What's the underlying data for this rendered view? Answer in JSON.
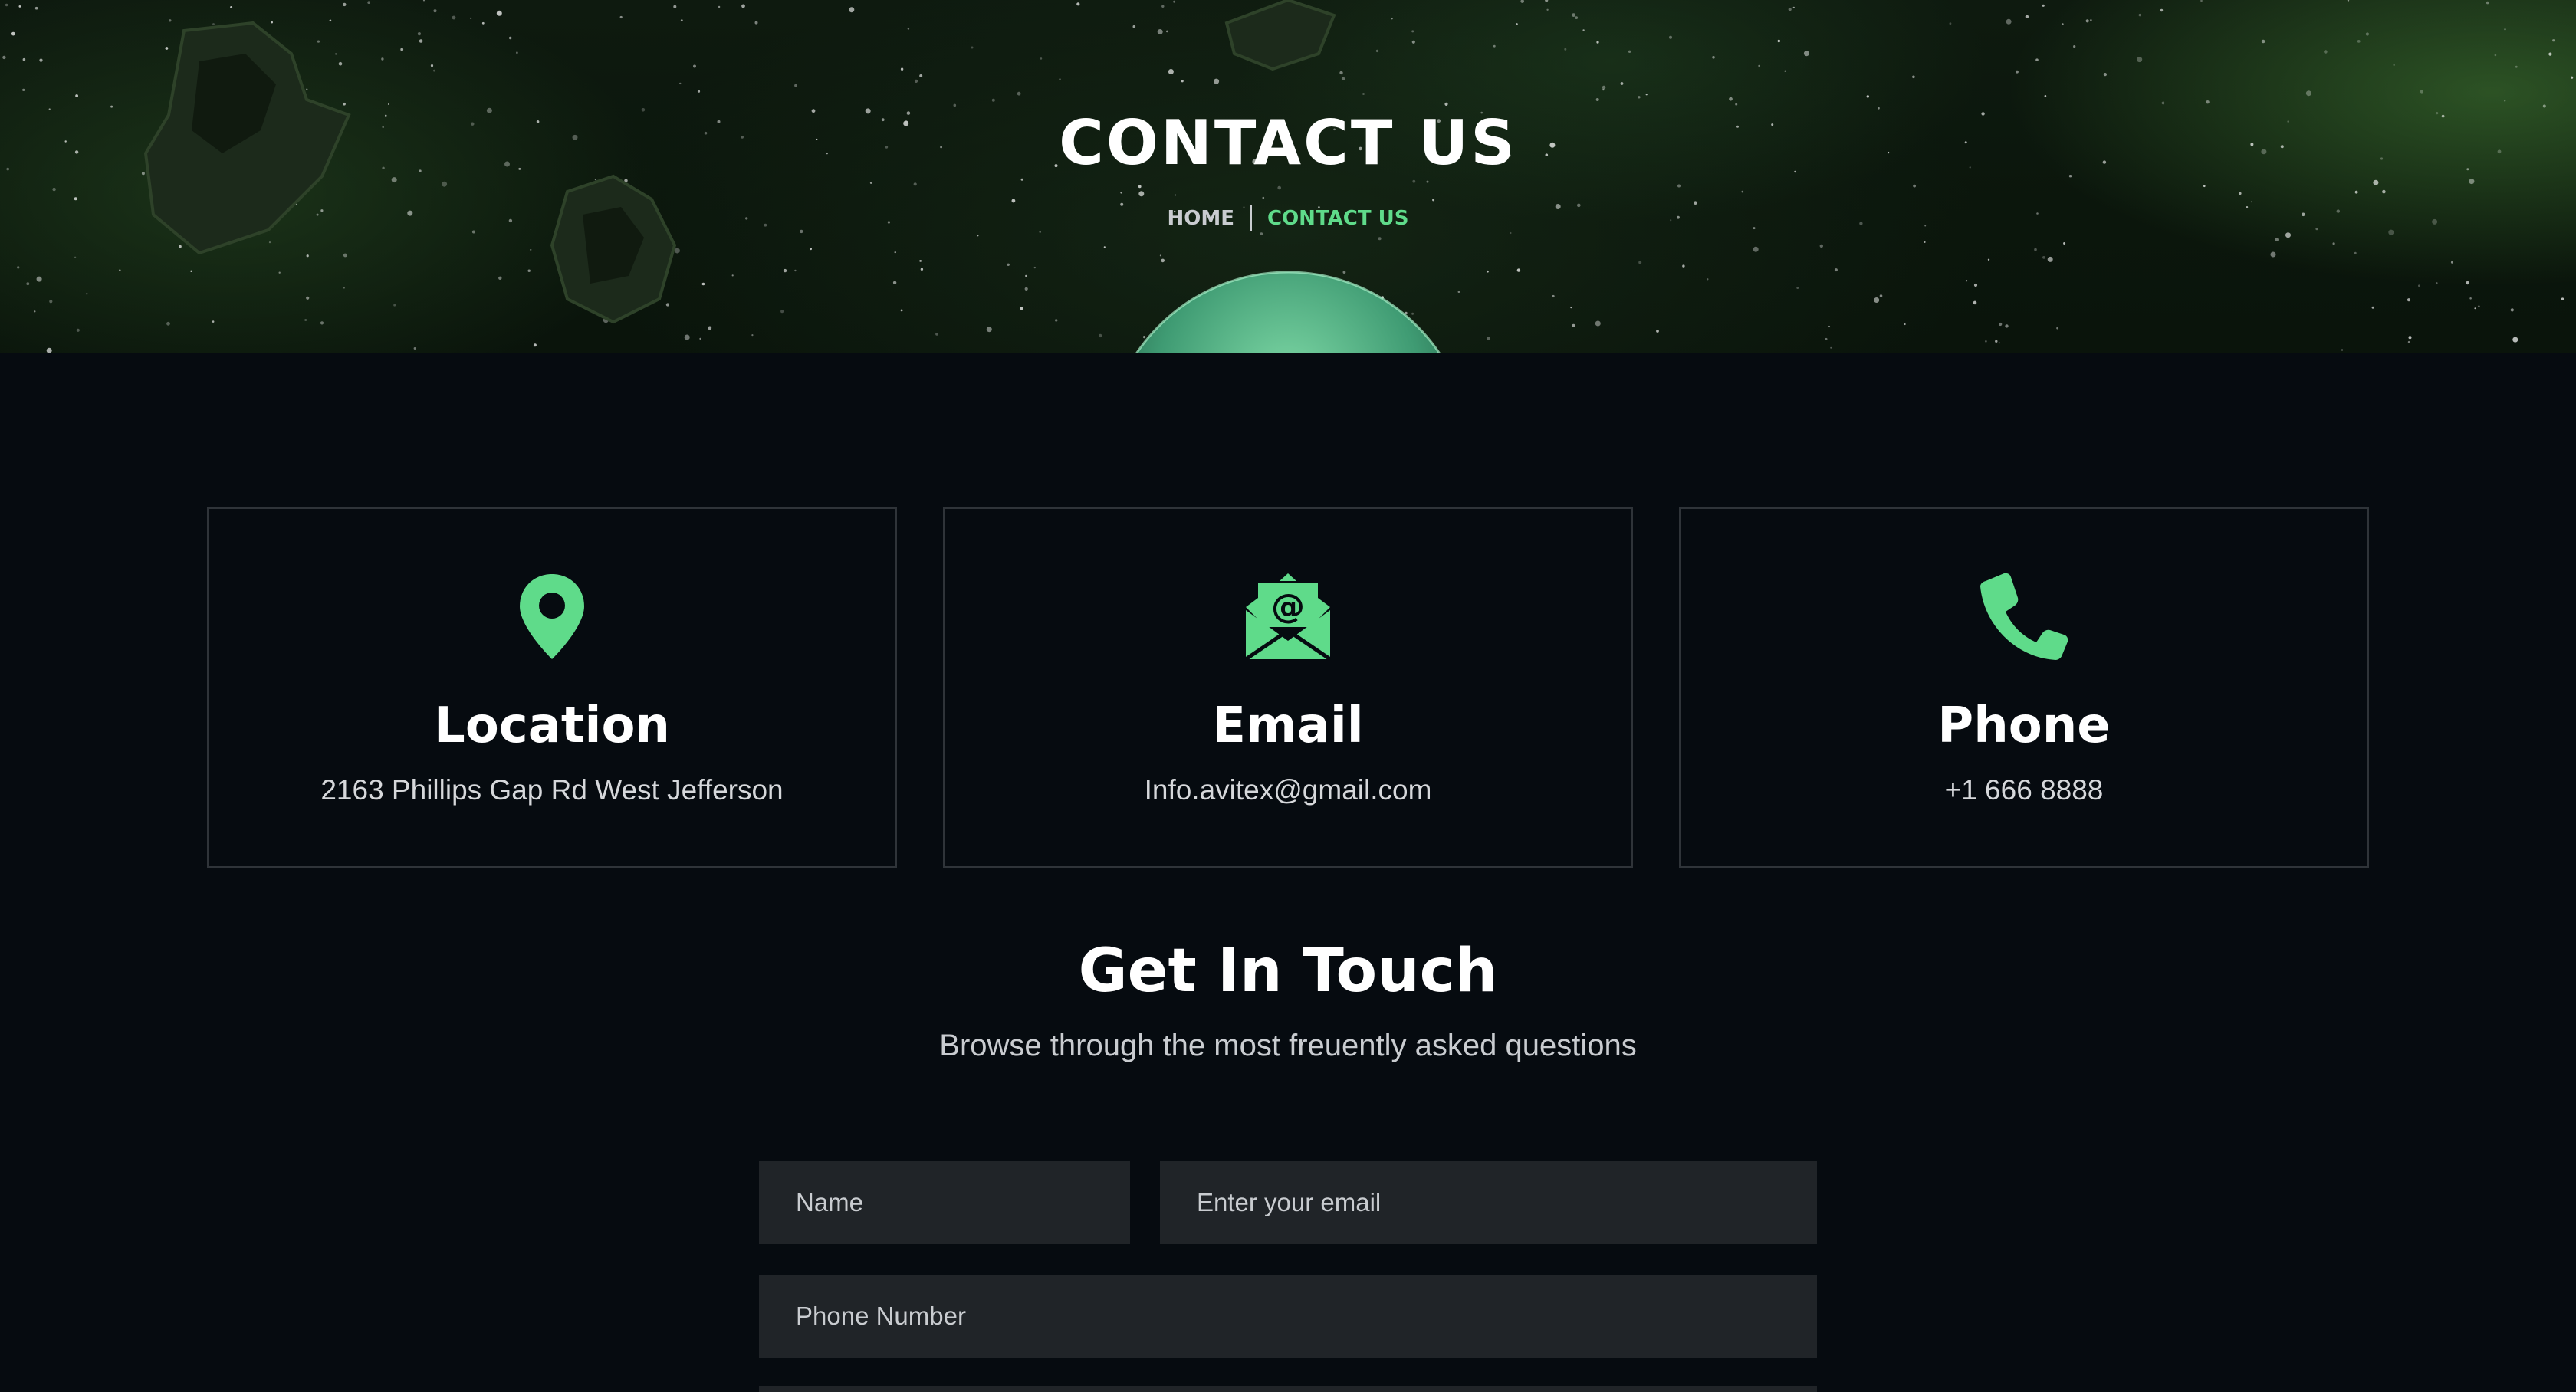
{
  "hero": {
    "title": "CONTACT US",
    "breadcrumb": {
      "home": "HOME",
      "current": "CONTACT US"
    }
  },
  "cards": [
    {
      "icon": "map-pin-icon",
      "title": "Location",
      "text": "2163 Phillips Gap Rd West Jefferson"
    },
    {
      "icon": "envelope-at-icon",
      "title": "Email",
      "text": "Info.avitex@gmail.com"
    },
    {
      "icon": "phone-icon",
      "title": "Phone",
      "text": "+1 666 8888"
    }
  ],
  "touch": {
    "title": "Get In Touch",
    "subtitle": "Browse through the most freuently asked questions"
  },
  "form": {
    "name_placeholder": "Name",
    "email_placeholder": "Enter your email",
    "phone_placeholder": "Phone Number"
  },
  "colors": {
    "accent": "#5fdb8a",
    "background": "#060b10",
    "field": "#202428"
  }
}
